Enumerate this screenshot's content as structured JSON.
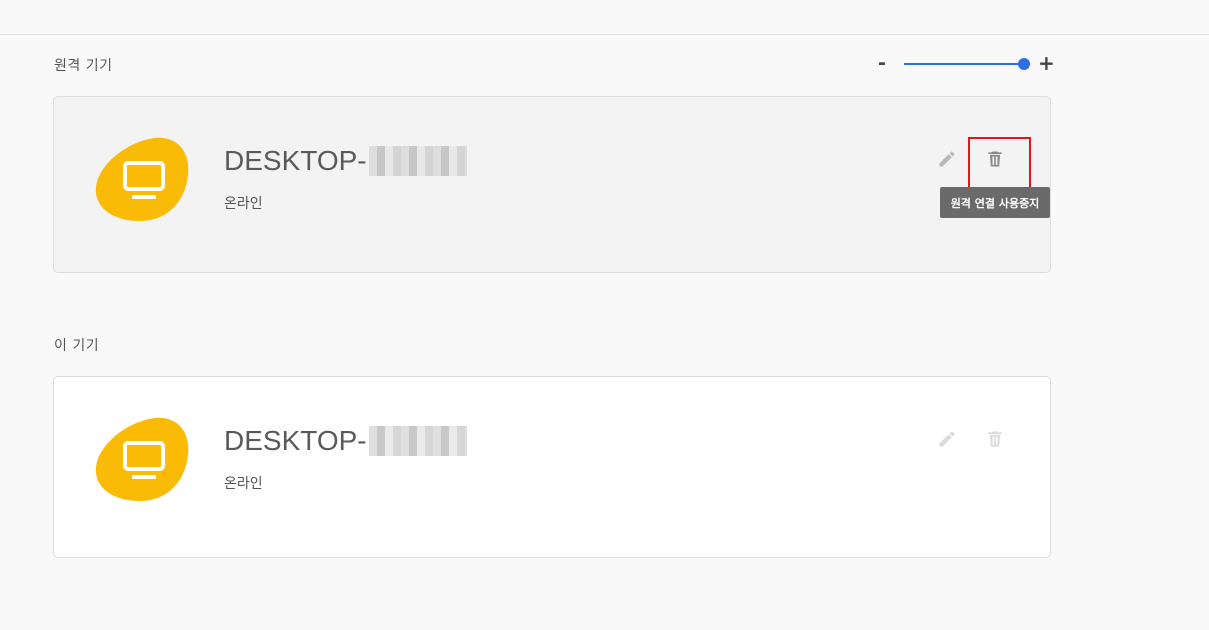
{
  "sections": {
    "remote": {
      "label": "원격 기기",
      "device": {
        "name": "DESKTOP-",
        "status": "온라인",
        "icon": "monitor-icon",
        "tooltip": "원격 연결 사용중지"
      }
    },
    "this": {
      "label": "이 기기",
      "device": {
        "name": "DESKTOP-",
        "status": "온라인",
        "icon": "monitor-icon"
      }
    }
  },
  "zoom": {
    "minus_label": "-",
    "plus_label": "+",
    "level": 1.0
  },
  "colors": {
    "accent": "#2d6fe3",
    "device_icon_bg": "#f9bb06",
    "highlight": "#e01818"
  }
}
